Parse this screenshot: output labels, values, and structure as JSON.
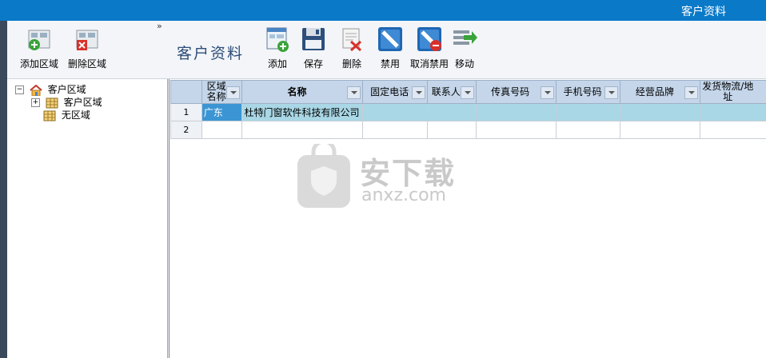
{
  "window": {
    "title": "客户资料"
  },
  "toolbar": {
    "add_region": "添加区域",
    "delete_region": "删除区域",
    "chevron": "»",
    "section_title": "客户资料",
    "add": "添加",
    "save": "保存",
    "delete": "删除",
    "disable": "禁用",
    "cancel_disable": "取消禁用",
    "move": "移动"
  },
  "tree": {
    "root": "客户区域",
    "child": "客户区域",
    "no_region": "无区域",
    "expand_root": "−",
    "expand_child": "+"
  },
  "grid": {
    "columns": [
      "区域名称",
      "名称",
      "固定电话",
      "联系人",
      "传真号码",
      "手机号码",
      "经营品牌",
      "发货物流/地址"
    ],
    "rows": [
      {
        "num": "1",
        "region": "广东",
        "name": "杜特门窗软件科技有限公司"
      },
      {
        "num": "2",
        "region": "",
        "name": ""
      }
    ]
  },
  "watermark": {
    "text": "安下载",
    "sub": "anxz.com"
  },
  "colors": {
    "titlebar": "#0a79c8",
    "header": "#c5d6ea",
    "selected_row": "#a9d7e5"
  }
}
